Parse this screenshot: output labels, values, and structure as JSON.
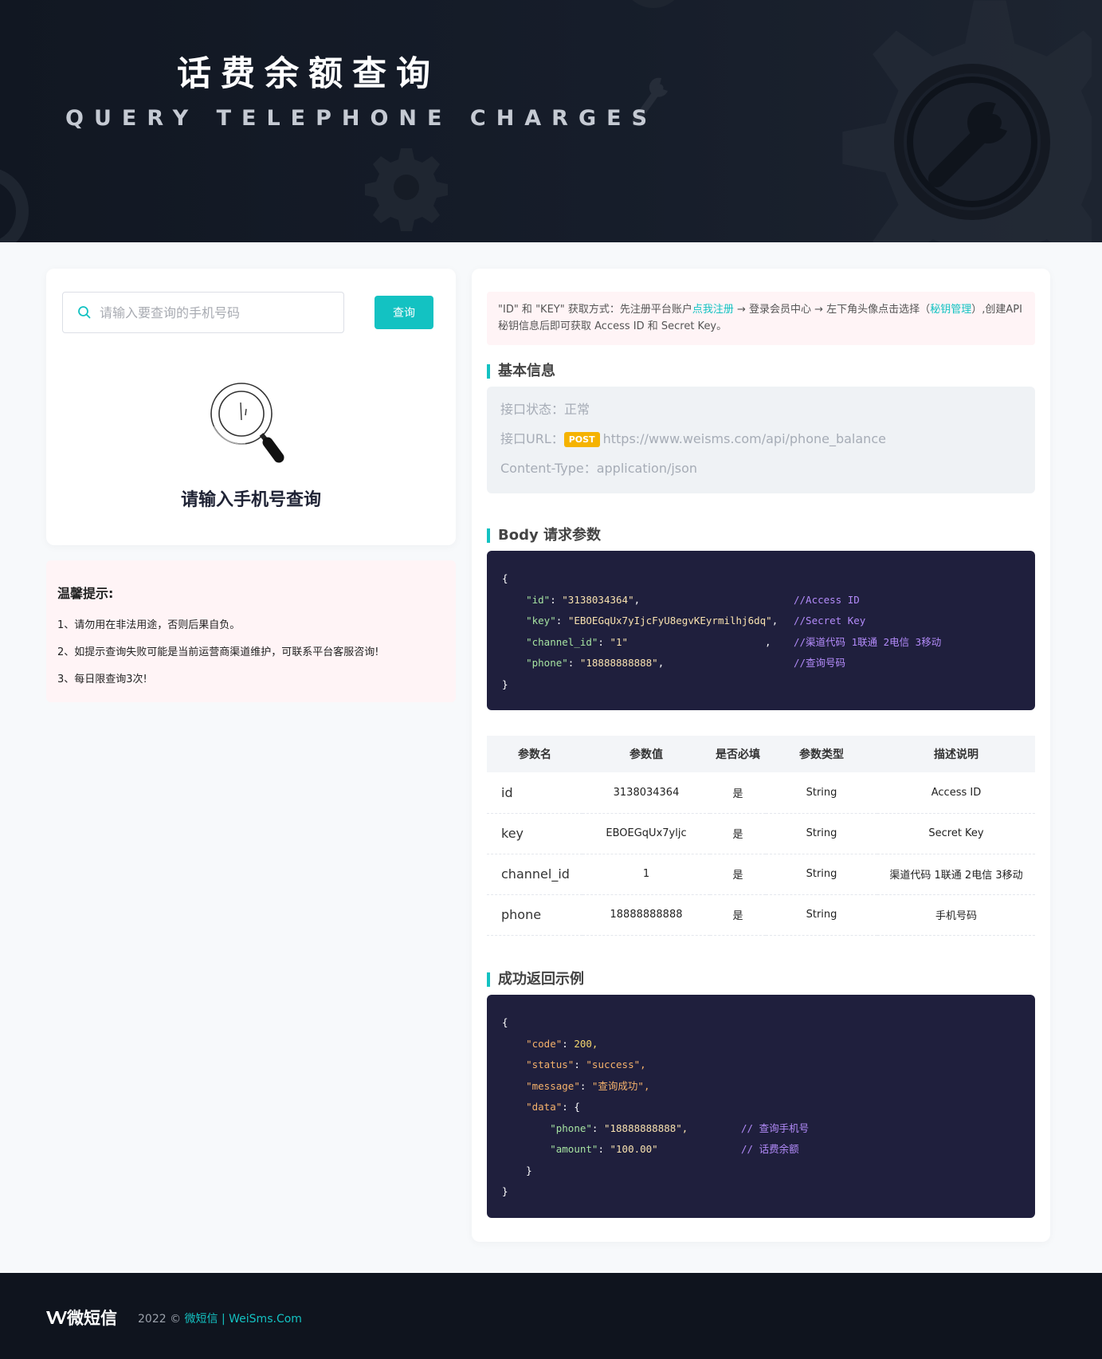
{
  "hero": {
    "title": "话费余额查询",
    "subtitle": "QUERY TELEPHONE CHARGES"
  },
  "search": {
    "placeholder": "请输入要查询的手机号码",
    "button_label": "查询",
    "empty_text": "请输入手机号查询"
  },
  "tips": {
    "title": "温馨提示:",
    "items": [
      "1、请勿用在非法用途，否则后果自负。",
      "2、如提示查询失败可能是当前运营商渠道维护，可联系平台客服咨询!",
      "3、每日限查询3次!"
    ]
  },
  "notice": {
    "part1": "\"ID\" 和 \"KEY\" 获取方式：先注册平台账户",
    "link1": "点我注册",
    "part2": " → 登录会员中心 → 左下角头像点击选择（",
    "link2": "秘钥管理",
    "part3": "）,创建API秘钥信息后即可获取 Access ID 和 Secret Key。"
  },
  "basic_info": {
    "section_title": "基本信息",
    "status_label": "接口状态：",
    "status_value": "正常",
    "url_label": "接口URL：",
    "method": "POST",
    "url": "https://www.weisms.com/api/phone_balance",
    "content_type_label": "Content-Type：",
    "content_type": "application/json"
  },
  "body_params": {
    "section_title": "Body 请求参数",
    "id_key": "\"id\"",
    "id_val": "\"3138034364\"",
    "id_comment": "//Access ID",
    "key_key": "\"key\"",
    "key_val": "\"EBOEGqUx7yIjcFyU8egvKEyrmilhj6dq\"",
    "key_comment": "//Secret Key",
    "channel_key": "\"channel_id\"",
    "channel_val": "\"1\"",
    "channel_comment": "//渠道代码 1联通 2电信 3移动",
    "phone_key": "\"phone\"",
    "phone_val": "\"18888888888\"",
    "phone_comment": "//查询号码"
  },
  "table": {
    "headers": [
      "参数名",
      "参数值",
      "是否必填",
      "参数类型",
      "描述说明"
    ],
    "rows": [
      [
        "id",
        "3138034364",
        "是",
        "String",
        "Access ID"
      ],
      [
        "key",
        "EBOEGqUx7yljc",
        "是",
        "String",
        "Secret Key"
      ],
      [
        "channel_id",
        "1",
        "是",
        "String",
        "渠道代码 1联通 2电信 3移动"
      ],
      [
        "phone",
        "18888888888",
        "是",
        "String",
        "手机号码"
      ]
    ]
  },
  "response": {
    "section_title": "成功返回示例",
    "code_key": "\"code\"",
    "code_val": "200,",
    "status_key": "\"status\"",
    "status_val": "\"success\",",
    "message_key": "\"message\"",
    "message_val": "\"查询成功\",",
    "data_key": "\"data\"",
    "phone_key": "\"phone\"",
    "phone_val": "\"18888888888\",",
    "phone_comment": "// 查询手机号",
    "amount_key": "\"amount\"",
    "amount_val": "\"100.00\"",
    "amount_comment": "// 话费余额"
  },
  "footer": {
    "logo": "微短信",
    "copyright": "2022 © ",
    "brand_link": "微短信 | WeiSms.Com"
  },
  "colors": {
    "accent": "#13c2c2",
    "post_badge": "#f5b301",
    "code_bg": "#1f1f3d"
  }
}
